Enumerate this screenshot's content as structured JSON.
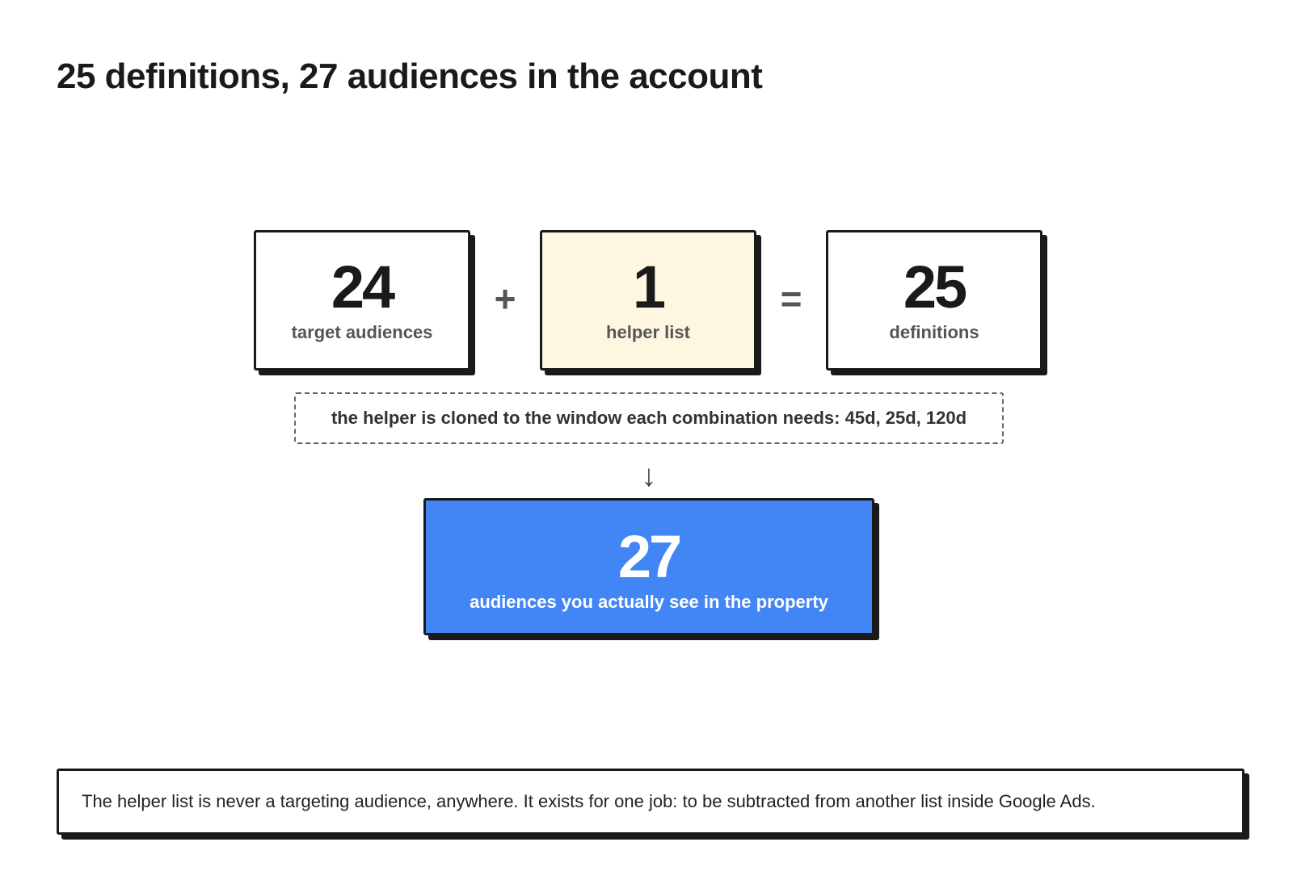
{
  "title": "25 definitions, 27 audiences in the account",
  "equation": {
    "target": {
      "value": "24",
      "label": "target audiences"
    },
    "plus": "+",
    "helper": {
      "value": "1",
      "label": "helper list"
    },
    "equals": "=",
    "definitions": {
      "value": "25",
      "label": "definitions"
    }
  },
  "note": "the helper is cloned to the window each combination needs: 45d, 25d, 120d",
  "arrow": "↓",
  "result": {
    "value": "27",
    "label": "audiences you actually see in the property"
  },
  "footer": "The helper list is never a targeting audience, anywhere. It exists for one job: to be subtracted from another list inside Google Ads.",
  "colors": {
    "result_fill": "#4285f4",
    "helper_fill": "#fdf7e2",
    "border": "#1a1a1a"
  }
}
